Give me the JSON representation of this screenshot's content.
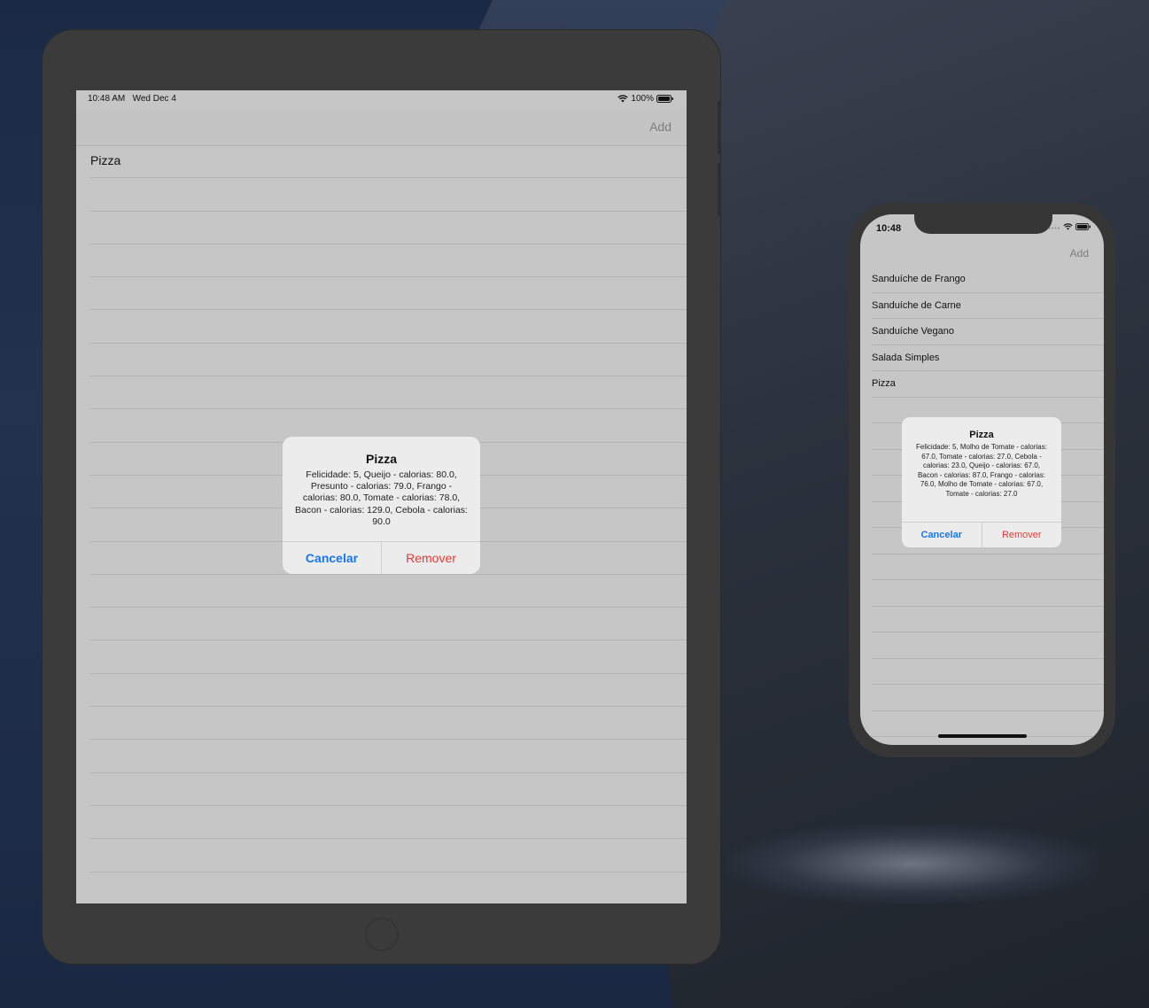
{
  "ipad": {
    "status": {
      "time": "10:48 AM",
      "date": "Wed Dec 4",
      "battery": "100%"
    },
    "nav": {
      "add_label": "Add"
    },
    "rows": [
      "Pizza",
      "",
      "",
      "",
      "",
      "",
      "",
      "",
      "",
      "",
      "",
      "",
      "",
      "",
      "",
      "",
      "",
      "",
      "",
      "",
      "",
      "",
      "",
      ""
    ],
    "alert": {
      "title": "Pizza",
      "message": "Felicidade: 5, Queijo - calorias: 80.0, Presunto - calorias: 79.0, Frango - calorias: 80.0, Tomate - calorias: 78.0, Bacon - calorias: 129.0, Cebola - calorias: 90.0",
      "cancel": "Cancelar",
      "remove": "Remover"
    }
  },
  "iphone": {
    "status": {
      "time": "10:48"
    },
    "nav": {
      "add_label": "Add"
    },
    "rows": [
      "Sanduíche de Frango",
      "Sanduíche de Carne",
      "Sanduíche Vegano",
      "Salada Simples",
      "Pizza",
      "",
      "",
      "",
      "",
      "",
      "",
      "",
      "",
      "",
      "",
      "",
      "",
      ""
    ],
    "alert": {
      "title": "Pizza",
      "message": "Felicidade: 5, Molho de Tomate - calorias: 67.0, Tomate - calorias: 27.0, Cebola - calorias: 23.0, Queijo - calorias: 67.0, Bacon - calorias: 87.0, Frango - calorias: 76.0, Molho de Tomate - calorias: 67.0, Tomate - calorias: 27.0",
      "cancel": "Cancelar",
      "remove": "Remover"
    }
  },
  "colors": {
    "accent": "#1877e8",
    "destructive": "#e53b35"
  }
}
